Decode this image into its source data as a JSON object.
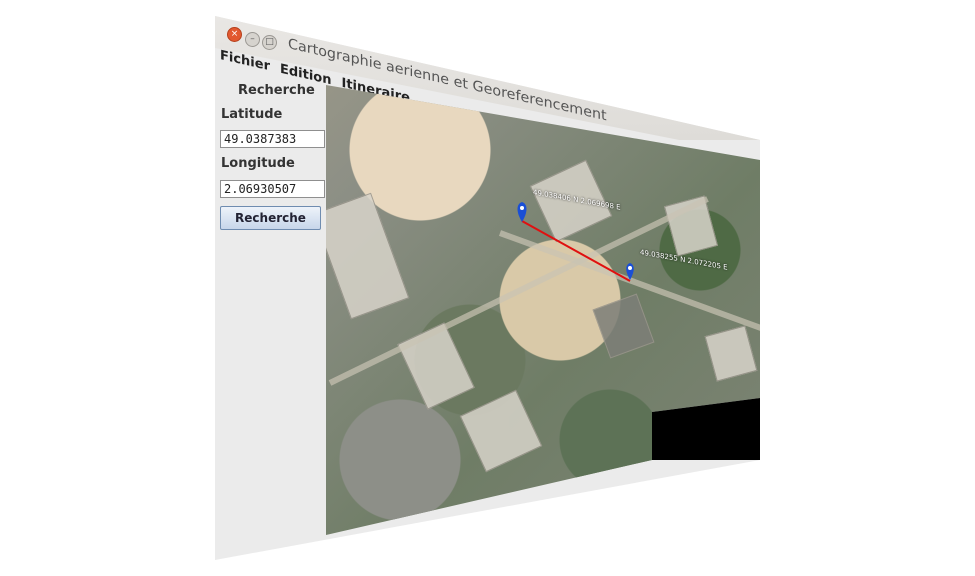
{
  "window": {
    "title": "Cartographie aerienne et Georeferencement",
    "controls": [
      "×",
      "–",
      "□"
    ]
  },
  "menu": [
    "Fichier",
    "Edition",
    "Itineraire"
  ],
  "panel": {
    "heading": "Recherche",
    "latitude_label": "Latitude",
    "latitude_value": "49.0387383",
    "longitude_label": "Longitude",
    "longitude_value": "2.06930507",
    "search_button": "Recherche"
  },
  "map": {
    "markers": [
      {
        "label": "49.038406 N 2.069698 E"
      },
      {
        "label": "49.038255 N 2.072205 E"
      }
    ],
    "route_color": "#e01010",
    "marker_color": "#1a4fd6"
  }
}
